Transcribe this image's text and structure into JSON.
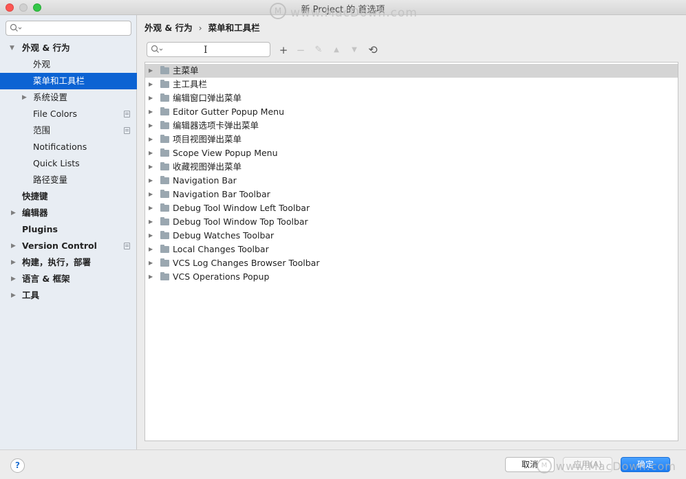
{
  "window": {
    "title": "新 Project 的 首选项",
    "watermark": "www.MacDown.com"
  },
  "sidebar": {
    "search_placeholder": "",
    "items": [
      {
        "label": "外观 & 行为",
        "expanded": true,
        "bold": true
      },
      {
        "label": "外观"
      },
      {
        "label": "菜单和工具栏",
        "selected": true
      },
      {
        "label": "系统设置",
        "collapsed": true
      },
      {
        "label": "File Colors",
        "copy_icon": true
      },
      {
        "label": "范围",
        "copy_icon": true
      },
      {
        "label": "Notifications"
      },
      {
        "label": "Quick Lists"
      },
      {
        "label": "路径变量"
      },
      {
        "label": "快捷键",
        "bold": true
      },
      {
        "label": "编辑器",
        "bold": true,
        "collapsed": true
      },
      {
        "label": "Plugins",
        "bold": true
      },
      {
        "label": "Version Control",
        "bold": true,
        "collapsed": true,
        "copy_icon": true
      },
      {
        "label": "构建，执行，部署",
        "bold": true,
        "collapsed": true
      },
      {
        "label": "语言 & 框架",
        "bold": true,
        "collapsed": true
      },
      {
        "label": "工具",
        "bold": true,
        "collapsed": true
      }
    ]
  },
  "breadcrumb": {
    "parent": "外观 & 行为",
    "separator": "›",
    "current": "菜单和工具栏"
  },
  "toolbar": {
    "search_value": "",
    "add_icon": "+",
    "remove_icon": "−",
    "edit_icon": "✎",
    "up_icon": "▲",
    "down_icon": "▼",
    "restore_icon": "⟲"
  },
  "menu_tree": [
    "主菜单",
    "主工具栏",
    "编辑窗口弹出菜单",
    "Editor Gutter Popup Menu",
    "编辑器选项卡弹出菜单",
    "项目视图弹出菜单",
    "Scope View Popup Menu",
    "收藏视图弹出菜单",
    "Navigation Bar",
    "Navigation Bar Toolbar",
    "Debug Tool Window Left Toolbar",
    "Debug Tool Window Top Toolbar",
    "Debug Watches Toolbar",
    "Local Changes Toolbar",
    "VCS Log Changes Browser Toolbar",
    "VCS Operations Popup"
  ],
  "footer": {
    "help_label": "?",
    "cancel_label": "取消",
    "apply_label": "应用(A)",
    "ok_label": "确定",
    "watermark": "www.MacDown.com"
  },
  "colors": {
    "selection": "#0c63d3",
    "row_selection": "#d4d4d4",
    "ok_button": "#1a7cf2"
  }
}
